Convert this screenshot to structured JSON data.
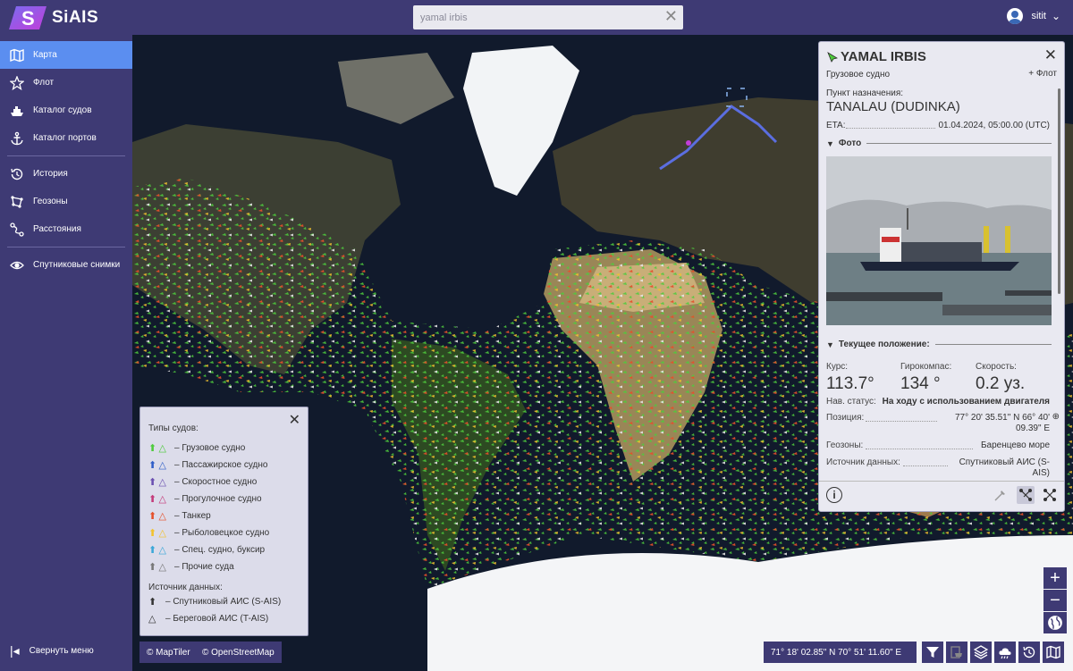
{
  "app": {
    "name": "SiAIS"
  },
  "search": {
    "value": "yamal irbis",
    "clear_icon": "close-icon"
  },
  "user": {
    "name": "sitit"
  },
  "sidebar": {
    "items": [
      {
        "label": "Карта",
        "icon": "map-icon",
        "active": true
      },
      {
        "label": "Флот",
        "icon": "star-icon"
      },
      {
        "label": "Каталог судов",
        "icon": "ship-icon"
      },
      {
        "label": "Каталог портов",
        "icon": "anchor-icon"
      },
      {
        "label": "История",
        "icon": "history-icon"
      },
      {
        "label": "Геозоны",
        "icon": "geozone-icon"
      },
      {
        "label": "Расстояния",
        "icon": "route-icon"
      },
      {
        "label": "Спутниковые снимки",
        "icon": "eye-icon"
      }
    ],
    "collapse_label": "Свернуть меню"
  },
  "legend": {
    "title": "Типы судов:",
    "types": [
      {
        "label": "– Грузовое судно",
        "color": "#4ecb3c"
      },
      {
        "label": "– Пассажирское судно",
        "color": "#2f5ec8"
      },
      {
        "label": "– Скоростное судно",
        "color": "#6a4fb0"
      },
      {
        "label": "– Прогулочное судно",
        "color": "#c43a7a"
      },
      {
        "label": "– Танкер",
        "color": "#e5502a"
      },
      {
        "label": "– Рыболовецкое судно",
        "color": "#f2c22e"
      },
      {
        "label": "– Спец. судно, буксир",
        "color": "#3aa7d8"
      },
      {
        "label": "– Прочие суда",
        "color": "#777777"
      }
    ],
    "source_title": "Источник данных:",
    "sources": [
      {
        "label": "– Спутниковый АИС (S-AIS)"
      },
      {
        "label": "– Береговой АИС (T-AIS)"
      }
    ]
  },
  "attribution": {
    "maptiler": "© MapTiler",
    "osm": "© OpenStreetMap"
  },
  "coordinates": "71° 18' 02.85\" N 70° 51' 11.60\" E",
  "zoom": {
    "in": "+",
    "out": "−"
  },
  "vessel": {
    "name": "YAMAL IRBIS",
    "type": "Грузовое судно",
    "fleet_label": "+ Флот",
    "destination_label": "Пункт назначения:",
    "destination": "TANALAU (DUDINKA)",
    "eta_label": "ETA:",
    "eta": "01.04.2024, 05:00.00 (UTC)",
    "photo_section": "Фото",
    "position_section": "Текущее положение:",
    "course_label": "Курс:",
    "course": "113.7°",
    "gyro_label": "Гирокомпас:",
    "gyro": "134 °",
    "speed_label": "Скорость:",
    "speed": "0.2 уз.",
    "nav_status_label": "Нав. статус:",
    "nav_status": "На ходу с использованием двигателя",
    "position_label": "Позиция:",
    "position_line1": "77° 20' 35.51\" N 66° 40'",
    "position_line2": "09.39\" E",
    "geozone_label": "Геозоны:",
    "geozone": "Баренцево море",
    "source_label": "Источник данных:",
    "source_line1": "Спутниковый АИС (S-",
    "source_line2": "AIS)"
  }
}
